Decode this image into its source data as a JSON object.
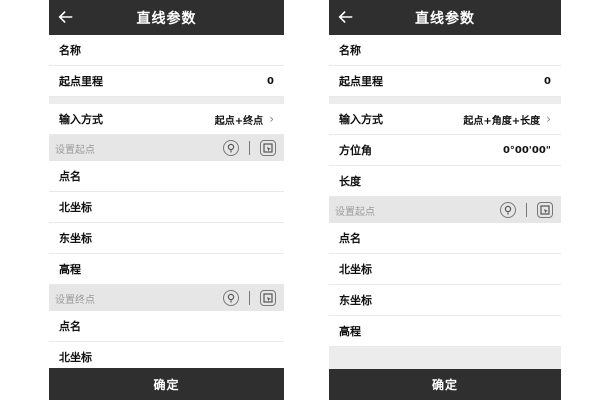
{
  "left": {
    "title": "直线参数",
    "name_label": "名称",
    "start_mileage_label": "起点里程",
    "start_mileage_value": "0",
    "input_mode_label": "输入方式",
    "input_mode_value": "起点+终点",
    "set_start_label": "设置起点",
    "start_rows": [
      "点名",
      "北坐标",
      "东坐标",
      "高程"
    ],
    "set_end_label": "设置终点",
    "end_rows": [
      "点名",
      "北坐标"
    ],
    "confirm_label": "确定"
  },
  "right": {
    "title": "直线参数",
    "name_label": "名称",
    "start_mileage_label": "起点里程",
    "start_mileage_value": "0",
    "input_mode_label": "输入方式",
    "input_mode_value": "起点+角度+长度",
    "azimuth_label": "方位角",
    "azimuth_value": "0°00'00\"",
    "length_label": "长度",
    "set_start_label": "设置起点",
    "start_rows": [
      "点名",
      "北坐标",
      "东坐标",
      "高程"
    ],
    "confirm_label": "确定"
  },
  "icons": {
    "back": "back-arrow-icon",
    "chevron": "chevron-right-icon",
    "locate": "location-pin-icon",
    "select": "point-select-icon"
  }
}
